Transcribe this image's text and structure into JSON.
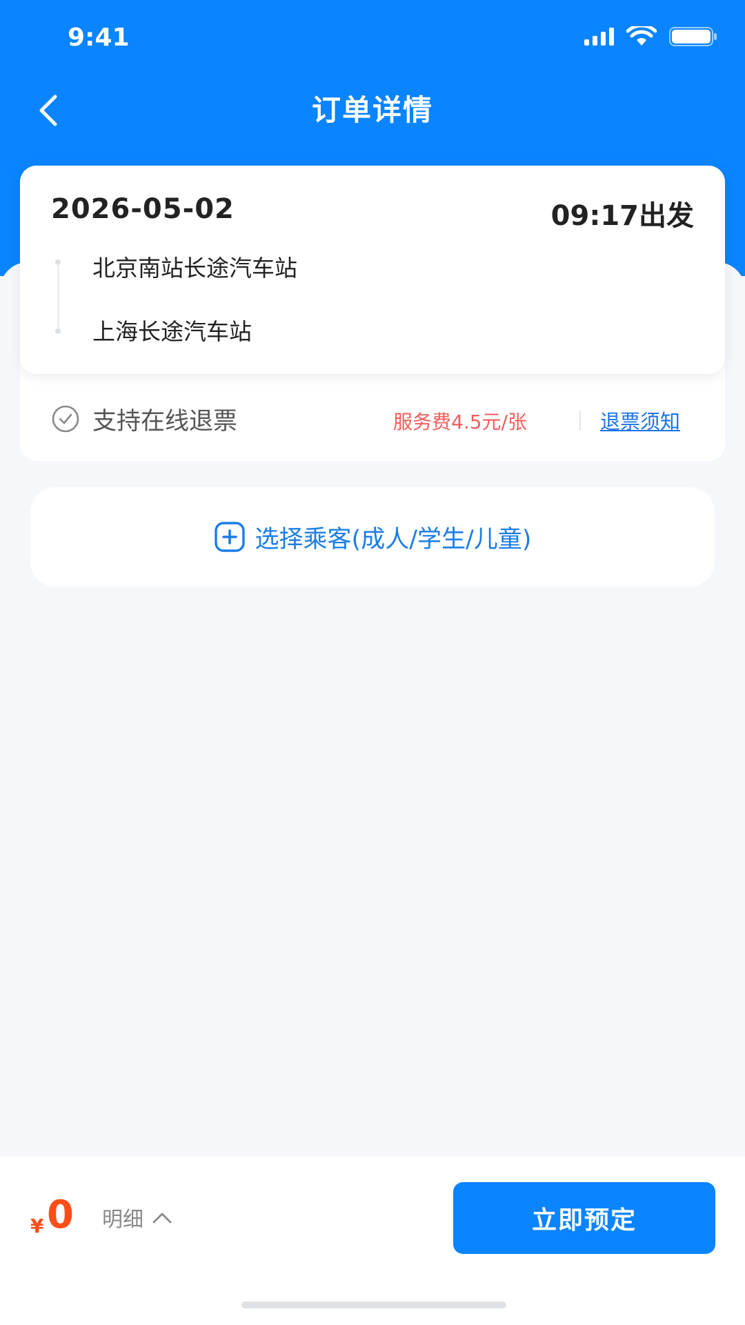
{
  "status_bar": {
    "time": "9:41"
  },
  "nav": {
    "title": "订单详情"
  },
  "trip": {
    "date": "2026-05-02",
    "departure": "09:17出发",
    "from_station": "北京南站长途汽车站",
    "to_station": "上海长途汽车站"
  },
  "refund": {
    "support_text": "支持在线退票",
    "fee_text": "服务费4.5元/张",
    "notice_link": "退票须知"
  },
  "passenger": {
    "select_label": "选择乘客(成人/学生/儿童)"
  },
  "bottom": {
    "currency": "¥",
    "price": "0",
    "detail_label": "明细",
    "book_label": "立即预定"
  },
  "colors": {
    "primary": "#0a84ff",
    "price": "#ff4d1a",
    "fee": "#f25c5c",
    "link": "#1a73e8"
  }
}
